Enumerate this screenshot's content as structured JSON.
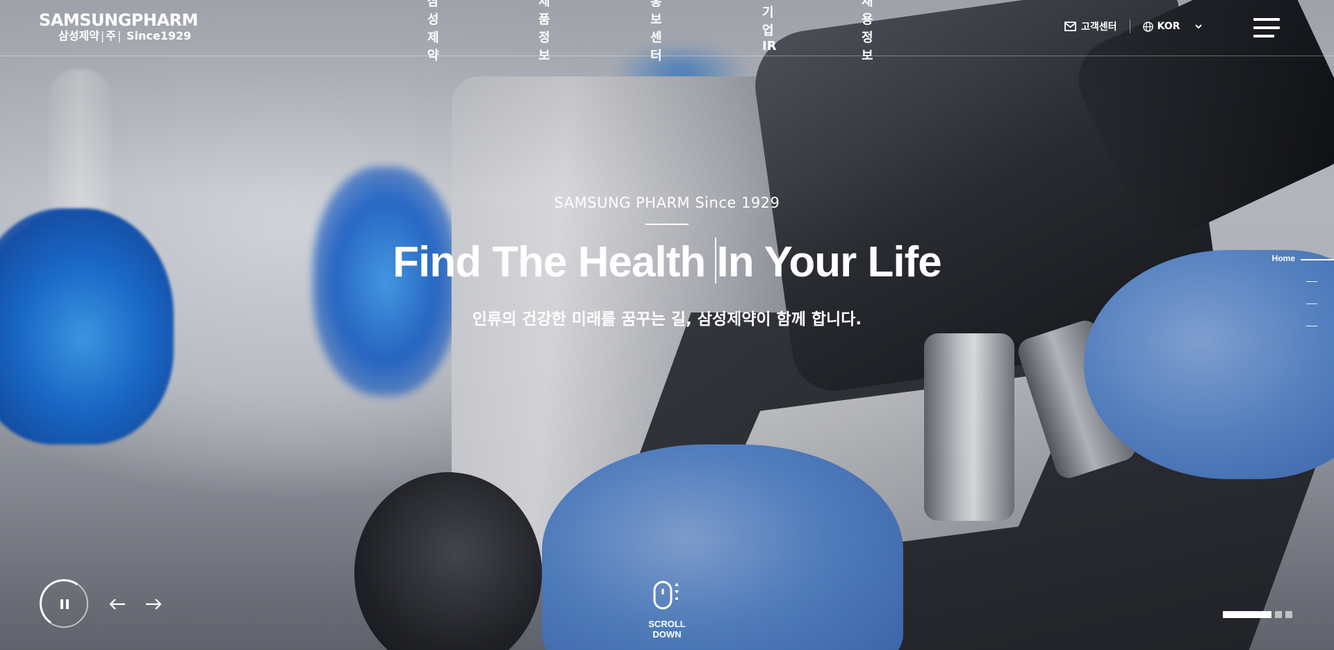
{
  "header": {
    "logo": {
      "brand": "SAMSUNGPHARM",
      "korean_name": "삼성제약",
      "corp_mark": "주",
      "since": "Since1929"
    },
    "nav": [
      "삼성제약",
      "제품정보",
      "홍보센터",
      "기업IR",
      "채용정보"
    ],
    "customer_center": "고객센터",
    "language": "KOR"
  },
  "hero": {
    "eyebrow": "SAMSUNG PHARM Since 1929",
    "title_part1": "Find The Health ",
    "title_part2": "In Your Life",
    "subtitle": "인류의 건강한 미래를 꿈꾸는 길, 삼성제약이 함께 합니다."
  },
  "side_nav": {
    "items": [
      "Home",
      "",
      "",
      ""
    ],
    "active_index": 0
  },
  "controls": {
    "scroll_label": "SCROLL DOWN",
    "slide_count": 3,
    "active_slide": 1
  },
  "colors": {
    "text": "#ffffff",
    "glove_blue": "#5a8ed8",
    "flask_blue": "#1565d8"
  },
  "icons": [
    "mail-icon",
    "globe-icon",
    "chevron-down-icon",
    "hamburger-menu-icon",
    "pause-icon",
    "arrow-left-icon",
    "arrow-right-icon",
    "mouse-scroll-icon"
  ]
}
